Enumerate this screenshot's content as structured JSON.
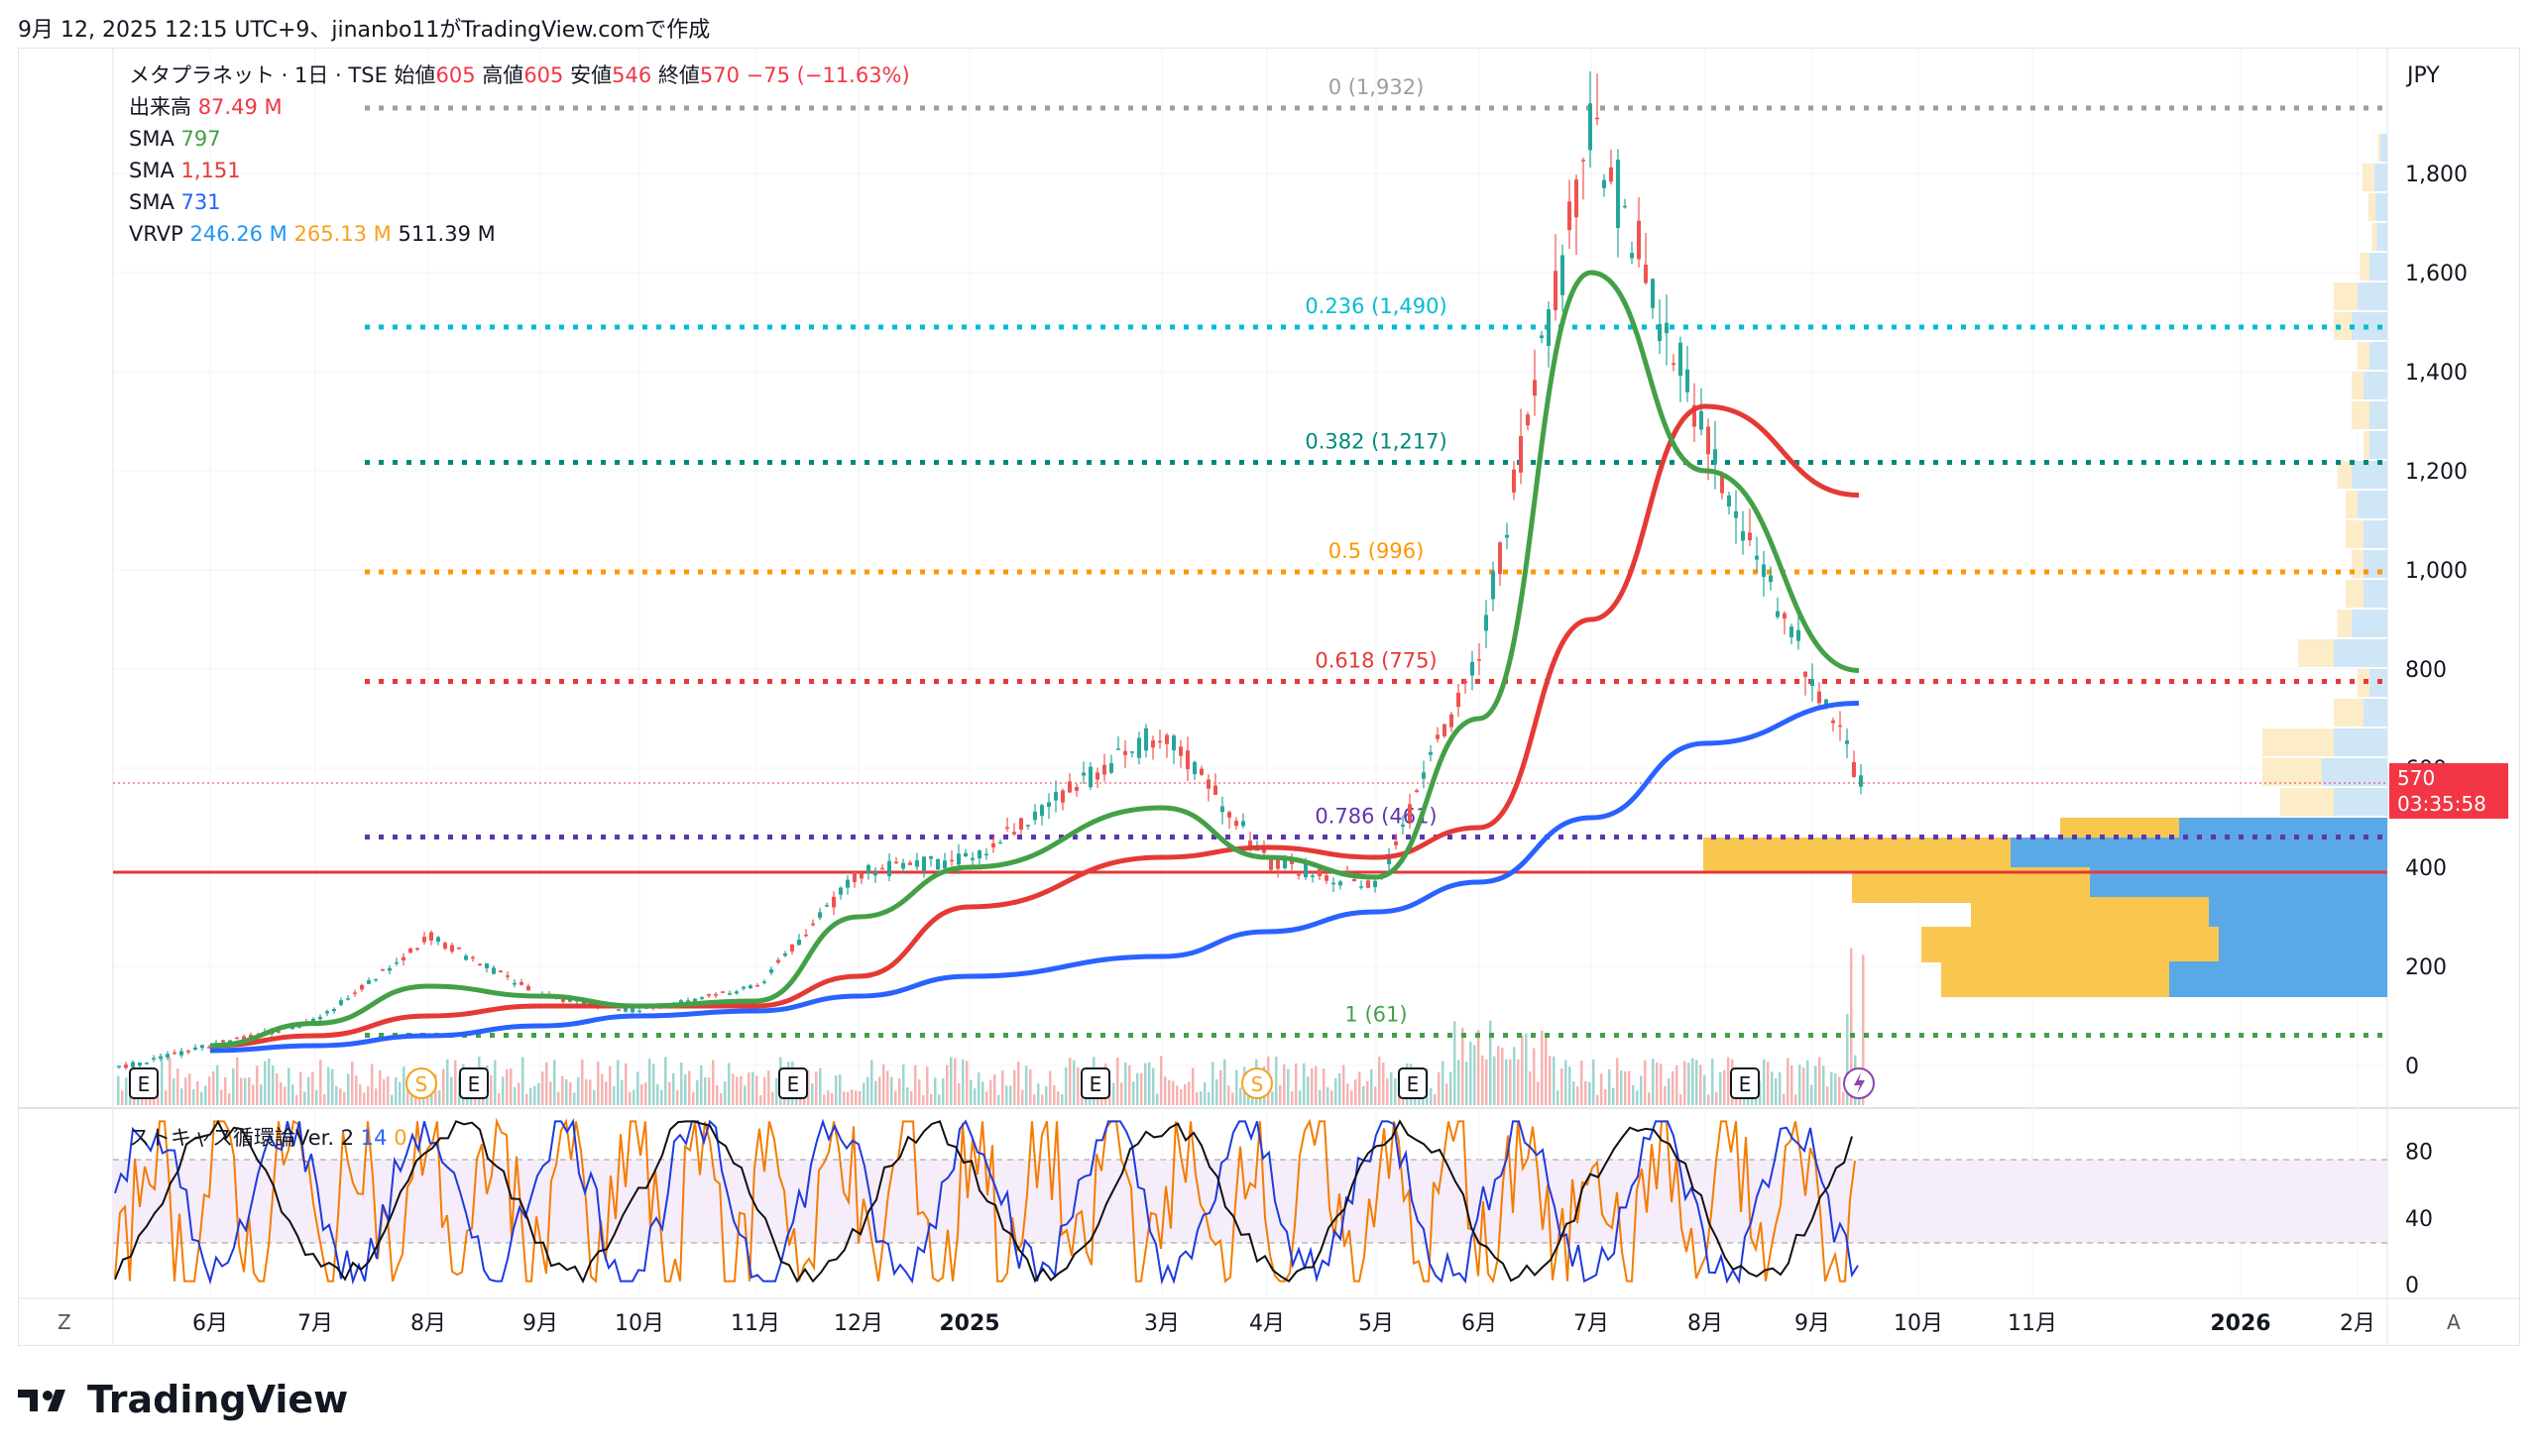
{
  "header": {
    "timestamp_text": "9月 12, 2025 12:15 UTC+9、jinanbo11がTradingView.comで作成"
  },
  "legend": {
    "symbol": "メタプラネット · 1日 · TSE",
    "open_label": "始値",
    "open": "605",
    "high_label": "高値",
    "high": "605",
    "low_label": "安値",
    "low": "546",
    "close_label": "終値",
    "close": "570",
    "change": "−75 (−11.63%)",
    "volume_label": "出来高",
    "volume": "87.49 M",
    "sma1_label": "SMA",
    "sma1": "797",
    "sma2_label": "SMA",
    "sma2": "1,151",
    "sma3_label": "SMA",
    "sma3": "731",
    "vrvp_label": "VRVP",
    "vrvp1": "246.26 M",
    "vrvp2": "265.13 M",
    "vrvp3": "511.39 M"
  },
  "oscillator": {
    "label": "ストキャス循環論Ver. 2",
    "p1": "14",
    "p2": "0"
  },
  "currency": "JPY",
  "price_tag": {
    "price": "570",
    "countdown": "03:35:58"
  },
  "bottom_left": "Z",
  "bottom_right": "A",
  "brand": "TradingView",
  "colors": {
    "up": "#26a69a",
    "down": "#ef5350",
    "sma_fast": "#43a047",
    "sma_mid": "#e53935",
    "sma_slow": "#2962ff",
    "vp_up": "#f9c74f",
    "vp_down": "#5aa9e6"
  },
  "chart_data": {
    "type": "line",
    "y_axis": {
      "ticks": [
        "0",
        "200",
        "400",
        "600",
        "800",
        "1,000",
        "1,200",
        "1,400",
        "1,600",
        "1,800"
      ],
      "ylim": [
        0,
        1950
      ]
    },
    "x_axis": {
      "ticks": [
        "6月",
        "7月",
        "8月",
        "9月",
        "10月",
        "11月",
        "12月",
        "2025",
        "3月",
        "4月",
        "5月",
        "6月",
        "7月",
        "8月",
        "9月",
        "10月",
        "11月",
        "2026",
        "2月"
      ]
    },
    "fibonacci": [
      {
        "label": "0 (1,932)",
        "value": 1932,
        "color": "#9e9e9e"
      },
      {
        "label": "0.236 (1,490)",
        "value": 1490,
        "color": "#00bcd4"
      },
      {
        "label": "0.382 (1,217)",
        "value": 1217,
        "color": "#00897b"
      },
      {
        "label": "0.5 (996)",
        "value": 996,
        "color": "#ff9800"
      },
      {
        "label": "0.618 (775)",
        "value": 775,
        "color": "#e53935"
      },
      {
        "label": "0.786 (461)",
        "value": 461,
        "color": "#5e35b1"
      },
      {
        "label": "1 (61)",
        "value": 61,
        "color": "#43a047"
      }
    ],
    "horizontal_line": {
      "value": 390,
      "color": "#e53935"
    },
    "price_series": {
      "name": "",
      "x": [
        "6月",
        "7月",
        "8月",
        "9月",
        "10月",
        "11月",
        "12月",
        "2025",
        "3月",
        "4月",
        "5月",
        "6月",
        "7月",
        "8月",
        "9月"
      ],
      "values": [
        40,
        90,
        260,
        140,
        110,
        160,
        390,
        420,
        680,
        410,
        360,
        850,
        1900,
        1250,
        570
      ]
    },
    "sma_fast_values": [
      40,
      85,
      160,
      140,
      120,
      130,
      300,
      400,
      520,
      420,
      380,
      700,
      1600,
      1200,
      797
    ],
    "sma_mid_values": [
      40,
      60,
      100,
      120,
      120,
      120,
      180,
      320,
      420,
      440,
      420,
      480,
      900,
      1330,
      1151
    ],
    "sma_slow_values": [
      30,
      40,
      60,
      80,
      100,
      110,
      140,
      180,
      220,
      270,
      310,
      370,
      500,
      650,
      731
    ],
    "osc_levels": [
      "80",
      "40",
      "0"
    ],
    "event_markers": [
      "E",
      "S",
      "E",
      "E",
      "E",
      "S",
      "E",
      "E"
    ]
  }
}
